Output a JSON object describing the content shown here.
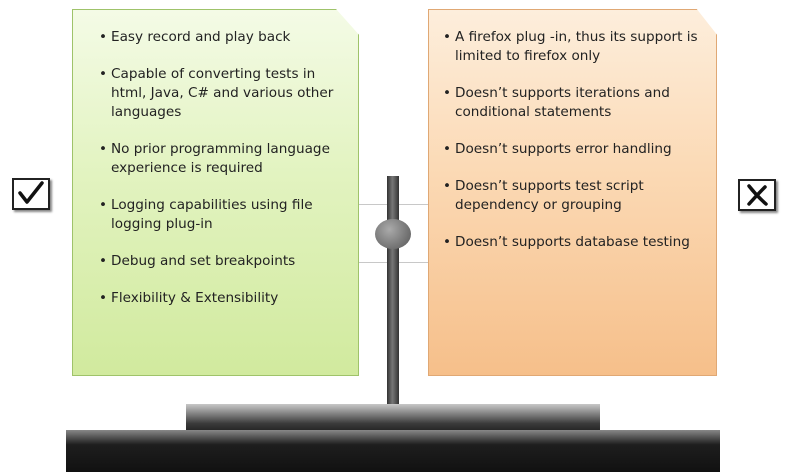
{
  "pros": {
    "icon": "check-mark-icon",
    "items": [
      "Easy record and play back",
      "Capable of converting tests in html, Java, C# and various other languages",
      "No prior programming language experience is required",
      "Logging capabilities using file logging plug-in",
      "Debug and set breakpoints",
      "Flexibility & Extensibility"
    ],
    "color": "#d9efb0"
  },
  "cons": {
    "icon": "cross-mark-icon",
    "items": [
      "A firefox plug -in, thus its support is limited to firefox only",
      "Doesn’t supports iterations and conditional statements",
      "Doesn’t supports error handling",
      "Doesn’t supports test script dependency or grouping",
      "Doesn’t supports database testing"
    ],
    "color": "#f9cfa2"
  },
  "bullet": "•",
  "colors": {
    "stand": "#333333"
  }
}
